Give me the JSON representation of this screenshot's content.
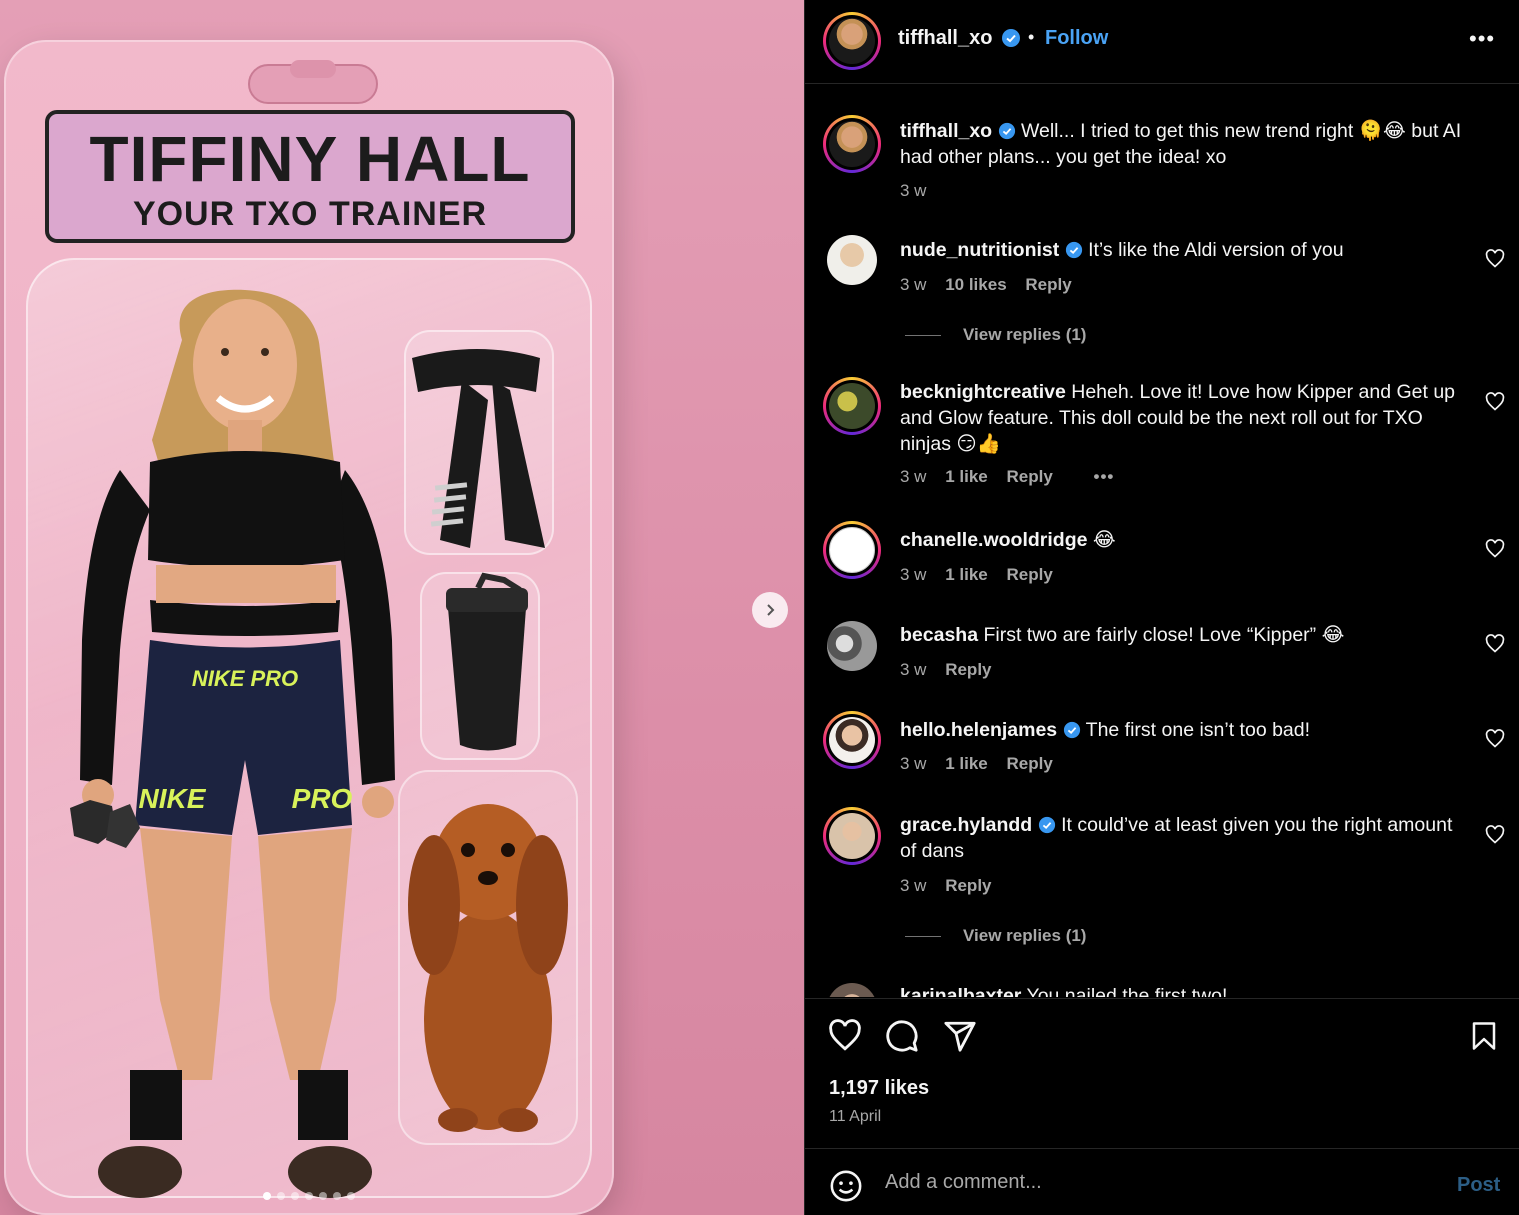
{
  "media": {
    "package_title": "TIFFINY HALL",
    "package_subtitle": "YOUR TXO TRAINER",
    "waistband_text": "NIKE PRO",
    "left_leg_text": "NIKE",
    "right_leg_text": "PRO",
    "carousel": {
      "count": 7,
      "active_index": 1
    },
    "colors": {
      "background": "#df94ac",
      "card": "#efb3c7",
      "title_box": "#dba7ce"
    }
  },
  "header": {
    "username": "tiffhall_xo",
    "separator": "•",
    "follow_label": "Follow",
    "more_label": "•••"
  },
  "caption": {
    "username": "tiffhall_xo",
    "text_a": "Well... I tried to get this new trend right",
    "emoji": "🫠😂",
    "text_b": "but AI had other plans... you get the idea! xo",
    "time": "3 w"
  },
  "comments": [
    {
      "username": "nude_nutritionist",
      "verified": true,
      "text": "It’s like the Aldi version of you",
      "time": "3 w",
      "likes": "10 likes",
      "reply": "Reply",
      "view_replies": "View replies (1)"
    },
    {
      "username": "becknightcreative",
      "verified": false,
      "text": "Heheh. Love it! Love how Kipper and Get up and Glow feature. This doll could be the next roll out for TXO ninjas 😏👍",
      "time": "3 w",
      "likes": "1 like",
      "reply": "Reply",
      "more": "•••"
    },
    {
      "username": "chanelle.wooldridge",
      "verified": false,
      "text": "😂",
      "time": "3 w",
      "likes": "1 like",
      "reply": "Reply"
    },
    {
      "username": "becasha",
      "verified": false,
      "text": "First two are fairly close! Love “Kipper” 😂",
      "time": "3 w",
      "reply": "Reply"
    },
    {
      "username": "hello.helenjames",
      "verified": true,
      "text": "The first one isn’t too bad!",
      "time": "3 w",
      "likes": "1 like",
      "reply": "Reply"
    },
    {
      "username": "grace.hylandd",
      "verified": true,
      "text": "It could’ve at least given you the right amount of dans",
      "time": "3 w",
      "reply": "Reply",
      "view_replies": "View replies (1)"
    },
    {
      "username": "karinalbaxter",
      "verified": false,
      "text": "You nailed the first two!"
    }
  ],
  "footer": {
    "likes": "1,197 likes",
    "date": "11 April",
    "comment_placeholder": "Add a comment...",
    "post_label": "Post"
  },
  "icons": [
    "heart-icon",
    "comment-icon",
    "share-icon",
    "bookmark-icon",
    "emoji-icon",
    "verified-badge-icon",
    "chevron-right-icon",
    "more-icon"
  ],
  "colors": {
    "panel_bg": "#000000",
    "link_blue": "#4aa3f5",
    "muted": "#a8a8a8",
    "verified": "#3897f0",
    "post_disabled": "#2c5e86"
  }
}
